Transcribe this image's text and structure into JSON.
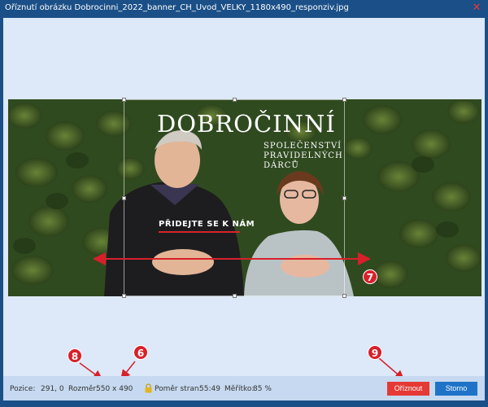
{
  "window": {
    "title": "Oříznutí obrázku Dobrocinni_2022_banner_CH_Uvod_VELKY_1180x490_responziv.jpg",
    "close_icon": "close-icon"
  },
  "banner": {
    "title": "DOBROČINNÍ",
    "subtitle_lines": [
      "SPOLEČENSTVÍ",
      "PRAVIDELNÝCH",
      "DÁRCŮ"
    ],
    "cta": "PŘIDEJTE SE K NÁM"
  },
  "annotations": {
    "marker_7": "7",
    "marker_8": "8",
    "marker_6": "6",
    "marker_9": "9",
    "color": "#d8202a"
  },
  "statusbar": {
    "position_label": "Pozice:",
    "position_value": "291, 0",
    "size_label": "Rozměr:",
    "size_value": "550 x 490",
    "ratio_label": "Poměr stran:",
    "ratio_value": "55:49",
    "scale_label": "Měřítko:",
    "scale_value": "85 %",
    "lock_icon": "lock-icon"
  },
  "buttons": {
    "crop_label": "Oříznout",
    "cancel_label": "Storno"
  },
  "colors": {
    "titlebar": "#1b4f87",
    "body": "#dde9f8",
    "crop_button": "#e53935",
    "cancel_button": "#1e73c8"
  }
}
